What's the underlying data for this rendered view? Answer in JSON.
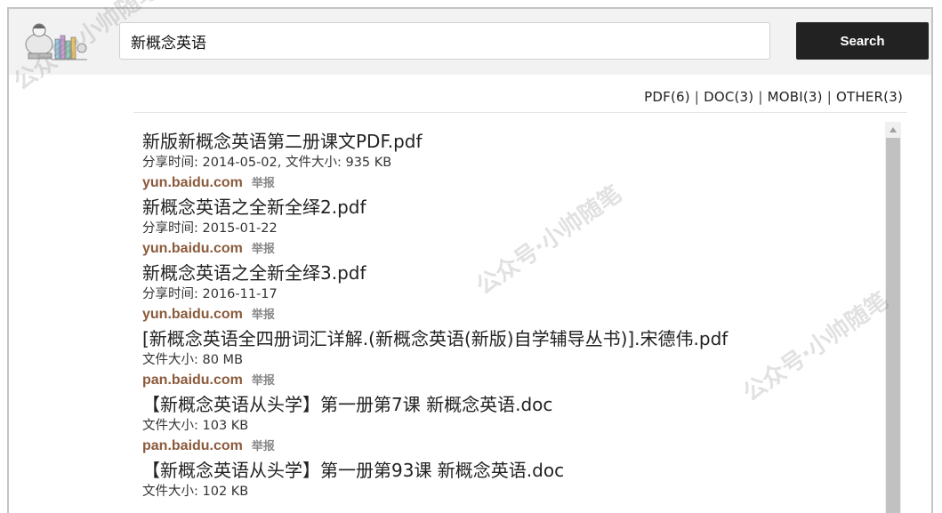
{
  "search": {
    "query": "新概念英语",
    "button_label": "Search"
  },
  "filters": [
    {
      "label": "PDF(6)"
    },
    {
      "label": "DOC(3)"
    },
    {
      "label": "MOBI(3)"
    },
    {
      "label": "OTHER(3)"
    }
  ],
  "filter_separator": "|",
  "results": [
    {
      "title": "新版新概念英语第二册课文PDF.pdf",
      "meta": "分享时间: 2014-05-02, 文件大小: 935 KB",
      "domain": "yun.baidu.com",
      "report": "举报"
    },
    {
      "title": "新概念英语之全新全绎2.pdf",
      "meta": "分享时间: 2015-01-22",
      "domain": "yun.baidu.com",
      "report": "举报"
    },
    {
      "title": "新概念英语之全新全绎3.pdf",
      "meta": "分享时间: 2016-11-17",
      "domain": "yun.baidu.com",
      "report": "举报"
    },
    {
      "title": "[新概念英语全四册词汇详解.(新概念英语(新版)自学辅导丛书)].宋德伟.pdf",
      "meta": "文件大小: 80 MB",
      "domain": "pan.baidu.com",
      "report": "举报"
    },
    {
      "title": "【新概念英语从头学】第一册第7课 新概念英语.doc",
      "meta": "文件大小: 103 KB",
      "domain": "pan.baidu.com",
      "report": "举报"
    },
    {
      "title": "【新概念英语从头学】第一册第93课 新概念英语.doc",
      "meta": "文件大小: 102 KB",
      "domain": "",
      "report": ""
    }
  ],
  "watermark": "公众号·小帅随笔",
  "colors": {
    "domain": "#8b5a3c",
    "button_bg": "#222222",
    "topbar_bg": "#f2f2f2"
  },
  "icons": {
    "logo": "reading-girl-books-logo",
    "scroll_up": "triangle-up-icon"
  }
}
